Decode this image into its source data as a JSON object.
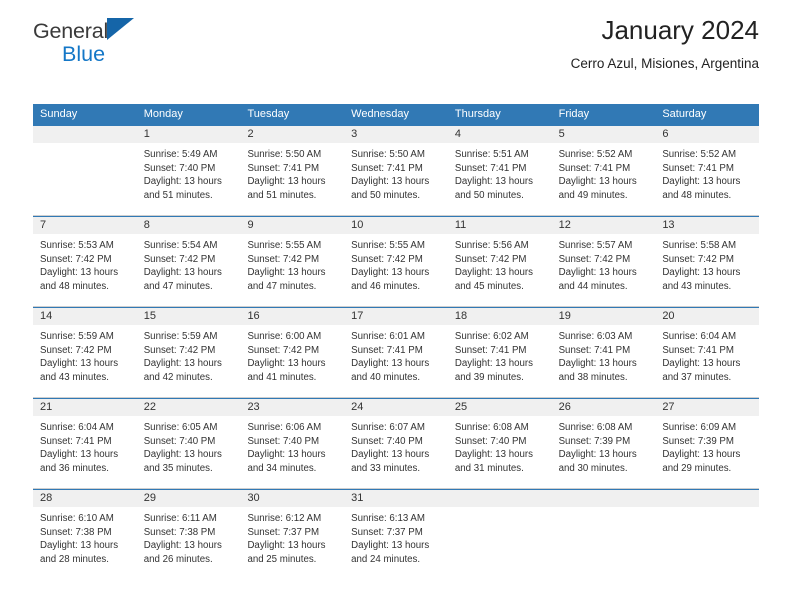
{
  "brand": {
    "name_part1": "General",
    "name_part2": "Blue",
    "triangle_color": "#1565a8",
    "blue_text_color": "#1477c7"
  },
  "header": {
    "title": "January 2024",
    "subtitle": "Cerro Azul, Misiones, Argentina"
  },
  "theme": {
    "header_row_bg": "#3179b5",
    "day_number_band_bg": "#f0f0f0",
    "separator_color": "#cfcfcf"
  },
  "weekdays": [
    "Sunday",
    "Monday",
    "Tuesday",
    "Wednesday",
    "Thursday",
    "Friday",
    "Saturday"
  ],
  "weeks": [
    {
      "days": [
        {
          "num": "",
          "sunrise": "",
          "sunset": "",
          "daylight1": "",
          "daylight2": ""
        },
        {
          "num": "1",
          "sunrise": "Sunrise: 5:49 AM",
          "sunset": "Sunset: 7:40 PM",
          "daylight1": "Daylight: 13 hours",
          "daylight2": "and 51 minutes."
        },
        {
          "num": "2",
          "sunrise": "Sunrise: 5:50 AM",
          "sunset": "Sunset: 7:41 PM",
          "daylight1": "Daylight: 13 hours",
          "daylight2": "and 51 minutes."
        },
        {
          "num": "3",
          "sunrise": "Sunrise: 5:50 AM",
          "sunset": "Sunset: 7:41 PM",
          "daylight1": "Daylight: 13 hours",
          "daylight2": "and 50 minutes."
        },
        {
          "num": "4",
          "sunrise": "Sunrise: 5:51 AM",
          "sunset": "Sunset: 7:41 PM",
          "daylight1": "Daylight: 13 hours",
          "daylight2": "and 50 minutes."
        },
        {
          "num": "5",
          "sunrise": "Sunrise: 5:52 AM",
          "sunset": "Sunset: 7:41 PM",
          "daylight1": "Daylight: 13 hours",
          "daylight2": "and 49 minutes."
        },
        {
          "num": "6",
          "sunrise": "Sunrise: 5:52 AM",
          "sunset": "Sunset: 7:41 PM",
          "daylight1": "Daylight: 13 hours",
          "daylight2": "and 48 minutes."
        }
      ]
    },
    {
      "days": [
        {
          "num": "7",
          "sunrise": "Sunrise: 5:53 AM",
          "sunset": "Sunset: 7:42 PM",
          "daylight1": "Daylight: 13 hours",
          "daylight2": "and 48 minutes."
        },
        {
          "num": "8",
          "sunrise": "Sunrise: 5:54 AM",
          "sunset": "Sunset: 7:42 PM",
          "daylight1": "Daylight: 13 hours",
          "daylight2": "and 47 minutes."
        },
        {
          "num": "9",
          "sunrise": "Sunrise: 5:55 AM",
          "sunset": "Sunset: 7:42 PM",
          "daylight1": "Daylight: 13 hours",
          "daylight2": "and 47 minutes."
        },
        {
          "num": "10",
          "sunrise": "Sunrise: 5:55 AM",
          "sunset": "Sunset: 7:42 PM",
          "daylight1": "Daylight: 13 hours",
          "daylight2": "and 46 minutes."
        },
        {
          "num": "11",
          "sunrise": "Sunrise: 5:56 AM",
          "sunset": "Sunset: 7:42 PM",
          "daylight1": "Daylight: 13 hours",
          "daylight2": "and 45 minutes."
        },
        {
          "num": "12",
          "sunrise": "Sunrise: 5:57 AM",
          "sunset": "Sunset: 7:42 PM",
          "daylight1": "Daylight: 13 hours",
          "daylight2": "and 44 minutes."
        },
        {
          "num": "13",
          "sunrise": "Sunrise: 5:58 AM",
          "sunset": "Sunset: 7:42 PM",
          "daylight1": "Daylight: 13 hours",
          "daylight2": "and 43 minutes."
        }
      ]
    },
    {
      "days": [
        {
          "num": "14",
          "sunrise": "Sunrise: 5:59 AM",
          "sunset": "Sunset: 7:42 PM",
          "daylight1": "Daylight: 13 hours",
          "daylight2": "and 43 minutes."
        },
        {
          "num": "15",
          "sunrise": "Sunrise: 5:59 AM",
          "sunset": "Sunset: 7:42 PM",
          "daylight1": "Daylight: 13 hours",
          "daylight2": "and 42 minutes."
        },
        {
          "num": "16",
          "sunrise": "Sunrise: 6:00 AM",
          "sunset": "Sunset: 7:42 PM",
          "daylight1": "Daylight: 13 hours",
          "daylight2": "and 41 minutes."
        },
        {
          "num": "17",
          "sunrise": "Sunrise: 6:01 AM",
          "sunset": "Sunset: 7:41 PM",
          "daylight1": "Daylight: 13 hours",
          "daylight2": "and 40 minutes."
        },
        {
          "num": "18",
          "sunrise": "Sunrise: 6:02 AM",
          "sunset": "Sunset: 7:41 PM",
          "daylight1": "Daylight: 13 hours",
          "daylight2": "and 39 minutes."
        },
        {
          "num": "19",
          "sunrise": "Sunrise: 6:03 AM",
          "sunset": "Sunset: 7:41 PM",
          "daylight1": "Daylight: 13 hours",
          "daylight2": "and 38 minutes."
        },
        {
          "num": "20",
          "sunrise": "Sunrise: 6:04 AM",
          "sunset": "Sunset: 7:41 PM",
          "daylight1": "Daylight: 13 hours",
          "daylight2": "and 37 minutes."
        }
      ]
    },
    {
      "days": [
        {
          "num": "21",
          "sunrise": "Sunrise: 6:04 AM",
          "sunset": "Sunset: 7:41 PM",
          "daylight1": "Daylight: 13 hours",
          "daylight2": "and 36 minutes."
        },
        {
          "num": "22",
          "sunrise": "Sunrise: 6:05 AM",
          "sunset": "Sunset: 7:40 PM",
          "daylight1": "Daylight: 13 hours",
          "daylight2": "and 35 minutes."
        },
        {
          "num": "23",
          "sunrise": "Sunrise: 6:06 AM",
          "sunset": "Sunset: 7:40 PM",
          "daylight1": "Daylight: 13 hours",
          "daylight2": "and 34 minutes."
        },
        {
          "num": "24",
          "sunrise": "Sunrise: 6:07 AM",
          "sunset": "Sunset: 7:40 PM",
          "daylight1": "Daylight: 13 hours",
          "daylight2": "and 33 minutes."
        },
        {
          "num": "25",
          "sunrise": "Sunrise: 6:08 AM",
          "sunset": "Sunset: 7:40 PM",
          "daylight1": "Daylight: 13 hours",
          "daylight2": "and 31 minutes."
        },
        {
          "num": "26",
          "sunrise": "Sunrise: 6:08 AM",
          "sunset": "Sunset: 7:39 PM",
          "daylight1": "Daylight: 13 hours",
          "daylight2": "and 30 minutes."
        },
        {
          "num": "27",
          "sunrise": "Sunrise: 6:09 AM",
          "sunset": "Sunset: 7:39 PM",
          "daylight1": "Daylight: 13 hours",
          "daylight2": "and 29 minutes."
        }
      ]
    },
    {
      "days": [
        {
          "num": "28",
          "sunrise": "Sunrise: 6:10 AM",
          "sunset": "Sunset: 7:38 PM",
          "daylight1": "Daylight: 13 hours",
          "daylight2": "and 28 minutes."
        },
        {
          "num": "29",
          "sunrise": "Sunrise: 6:11 AM",
          "sunset": "Sunset: 7:38 PM",
          "daylight1": "Daylight: 13 hours",
          "daylight2": "and 26 minutes."
        },
        {
          "num": "30",
          "sunrise": "Sunrise: 6:12 AM",
          "sunset": "Sunset: 7:37 PM",
          "daylight1": "Daylight: 13 hours",
          "daylight2": "and 25 minutes."
        },
        {
          "num": "31",
          "sunrise": "Sunrise: 6:13 AM",
          "sunset": "Sunset: 7:37 PM",
          "daylight1": "Daylight: 13 hours",
          "daylight2": "and 24 minutes."
        },
        {
          "num": "",
          "sunrise": "",
          "sunset": "",
          "daylight1": "",
          "daylight2": ""
        },
        {
          "num": "",
          "sunrise": "",
          "sunset": "",
          "daylight1": "",
          "daylight2": ""
        },
        {
          "num": "",
          "sunrise": "",
          "sunset": "",
          "daylight1": "",
          "daylight2": ""
        }
      ]
    }
  ]
}
